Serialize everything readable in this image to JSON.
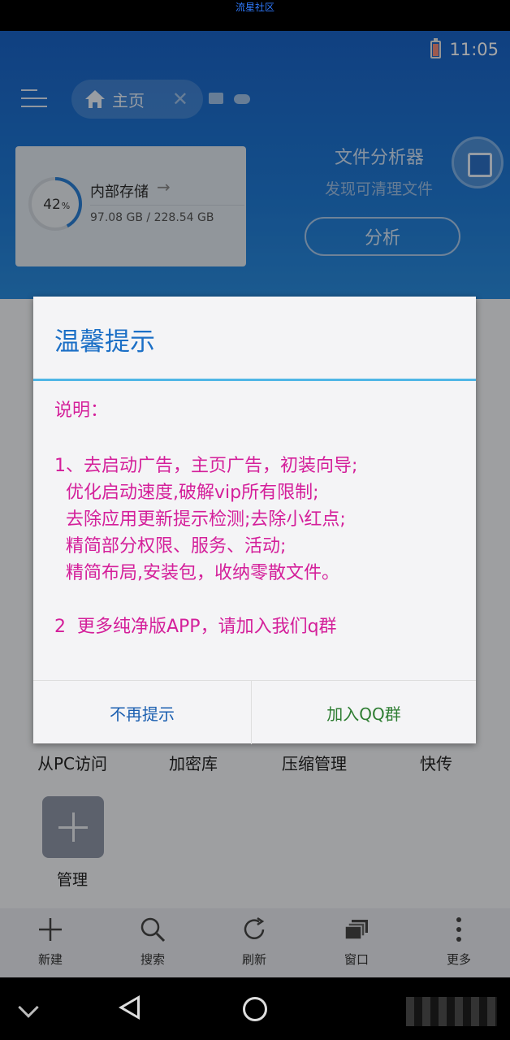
{
  "watermark": "流星社区",
  "status": {
    "time": "11:05"
  },
  "header": {
    "home_tab_label": "主页",
    "close_glyph": "✕"
  },
  "storage": {
    "percent": "42",
    "percent_sign": "%",
    "title": "内部存储",
    "arrow": "→",
    "size": "97.08 GB / 228.54 GB",
    "used_fraction": 0.42
  },
  "analyzer": {
    "title": "文件分析器",
    "subtitle": "发现可清理文件",
    "button": "分析"
  },
  "grid": {
    "labels": [
      "从PC访问",
      "加密库",
      "压缩管理",
      "快传"
    ],
    "manage": "管理"
  },
  "bottom_bar": [
    {
      "label": "新建",
      "icon": "plus-icon"
    },
    {
      "label": "搜索",
      "icon": "search-icon"
    },
    {
      "label": "刷新",
      "icon": "refresh-icon"
    },
    {
      "label": "窗口",
      "icon": "windows-icon"
    },
    {
      "label": "更多",
      "icon": "more-icon"
    }
  ],
  "dialog": {
    "title": "温馨提示",
    "body": [
      "说明：",
      "1、去启动广告，主页广告，初装向导;",
      "  优化启动速度,破解vip所有限制;",
      "  去除应用更新提示检测;去除小红点;",
      "  精简部分权限、服务、活动;",
      "  精简布局,安装包，收纳零散文件。",
      "2  更多纯净版APP，请加入我们q群"
    ],
    "btn_dismiss": "不再提示",
    "btn_join": "加入QQ群"
  },
  "colors": {
    "accent_blue": "#1b6fc6",
    "body_magenta": "#d41f9a",
    "join_green": "#2e7d32",
    "dismiss_blue": "#1b5fb0"
  }
}
